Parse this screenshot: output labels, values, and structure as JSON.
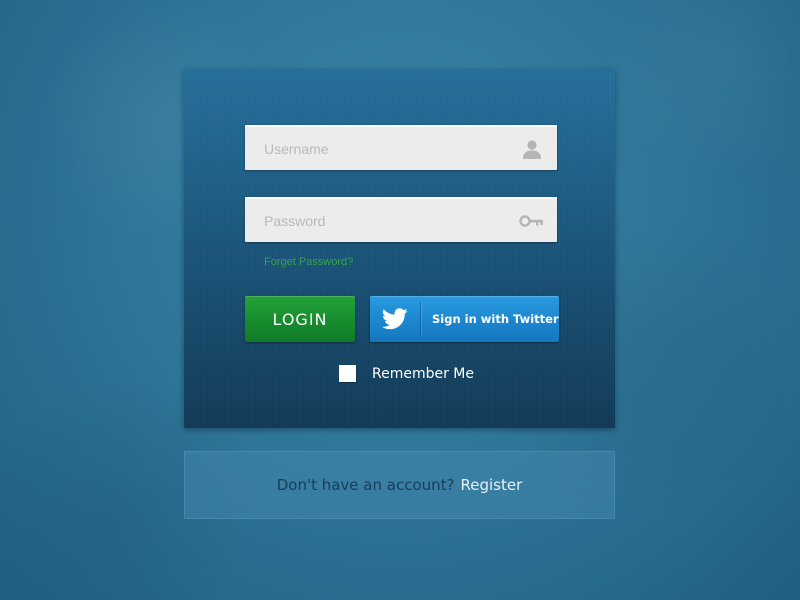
{
  "login_form": {
    "username": {
      "placeholder": "Username",
      "value": "",
      "icon": "user-icon"
    },
    "password": {
      "placeholder": "Password",
      "value": "",
      "icon": "key-icon"
    },
    "forgot_password_label": "Forget Password?",
    "login_label": "LOGIN",
    "twitter_label": "Sign in with Twitter",
    "twitter_icon": "twitter-bird-icon",
    "remember_me_label": "Remember Me",
    "remember_me_checked": false
  },
  "register": {
    "prompt": "Don't have an account?",
    "link_label": "Register"
  },
  "colors": {
    "background": "#2f7799",
    "panel_top": "#246f9a",
    "panel_bottom": "#123a57",
    "login_button": "#178c2e",
    "twitter_button": "#1c86cf",
    "forgot_link": "#33a54a",
    "field_background": "#ececec",
    "register_prompt": "#173d57",
    "register_link": "#e6f1f7"
  }
}
